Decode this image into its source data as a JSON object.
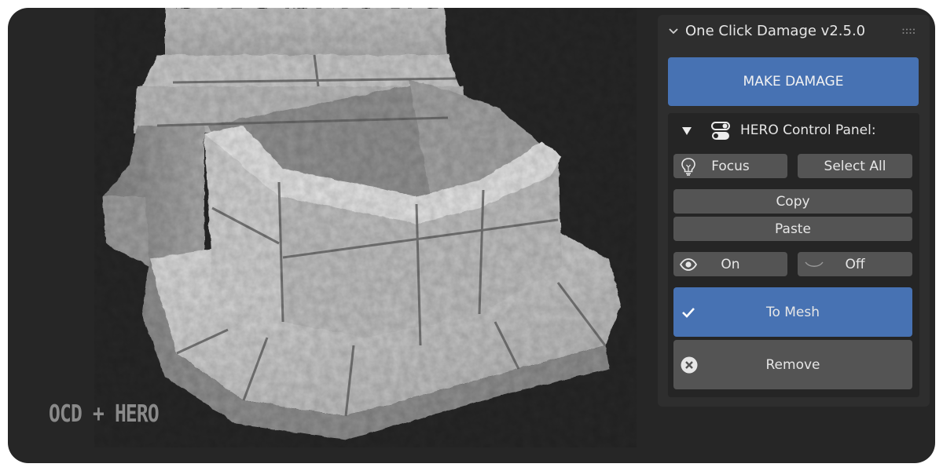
{
  "watermark": "OCD + HERO",
  "panel": {
    "title": "One Click Damage v2.5.0",
    "make_damage_label": "MAKE DAMAGE",
    "hero": {
      "title": "HERO Control Panel:",
      "focus_label": "Focus",
      "select_all_label": "Select All",
      "copy_label": "Copy",
      "paste_label": "Paste",
      "on_label": "On",
      "off_label": "Off",
      "to_mesh_label": "To Mesh",
      "remove_label": "Remove"
    }
  },
  "colors": {
    "accent": "#4772b3",
    "button": "#545454",
    "panel": "#2e2e2e",
    "subpanel": "#252525",
    "viewport": "#262626"
  },
  "icons": {
    "header_chevron": "chevron-down-icon",
    "drag_handle": "grip-icon",
    "collapse": "triangle-down-icon",
    "panel_type": "toggle-switch-icon",
    "focus": "lightbulb-icon",
    "on": "eye-icon",
    "off": "eye-closed-icon",
    "to_mesh": "checkmark-icon",
    "remove": "x-circle-icon"
  }
}
